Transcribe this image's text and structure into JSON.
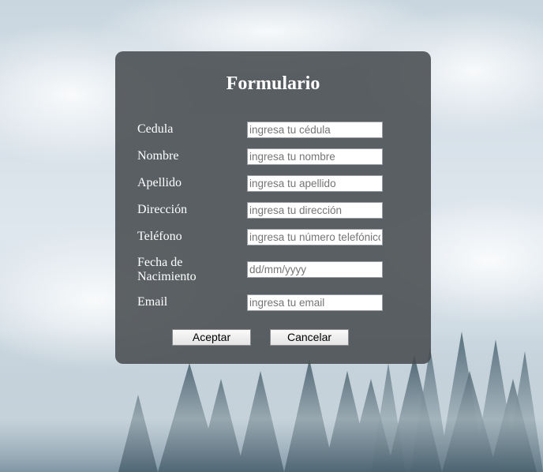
{
  "form": {
    "title": "Formulario",
    "fields": [
      {
        "label": "Cedula",
        "placeholder": "ingresa tu cédula"
      },
      {
        "label": "Nombre",
        "placeholder": "ingresa tu nombre"
      },
      {
        "label": "Apellido",
        "placeholder": "ingresa tu apellido"
      },
      {
        "label": "Dirección",
        "placeholder": "ingresa tu dirección"
      },
      {
        "label": "Teléfono",
        "placeholder": "ingresa tu número telefónico"
      },
      {
        "label": "Fecha de Nacimiento",
        "placeholder": "dd/mm/yyyy"
      },
      {
        "label": "Email",
        "placeholder": "ingresa tu email"
      }
    ],
    "accept_label": "Aceptar",
    "cancel_label": "Cancelar"
  },
  "colors": {
    "panel": "#484c50",
    "text": "#ffffff",
    "sky": "#d6e0e8",
    "forest": "#2f4a58"
  }
}
